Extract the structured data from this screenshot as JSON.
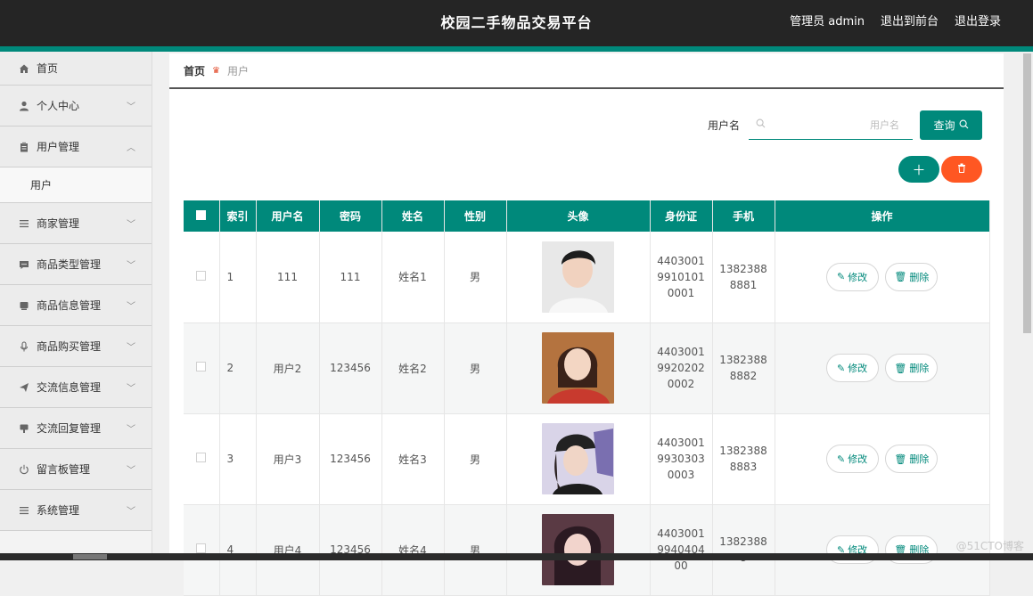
{
  "header": {
    "title": "校园二手物品交易平台",
    "admin_label": "管理员 admin",
    "back_to_front": "退出到前台",
    "logout": "退出登录"
  },
  "sidebar": {
    "items": [
      {
        "label": "首页",
        "icon": "home-icon"
      },
      {
        "label": "个人中心",
        "icon": "user-icon"
      },
      {
        "label": "用户管理",
        "icon": "clipboard-icon"
      },
      {
        "label": "商家管理",
        "icon": "list-icon"
      },
      {
        "label": "商品类型管理",
        "icon": "chat-icon"
      },
      {
        "label": "商品信息管理",
        "icon": "box-icon"
      },
      {
        "label": "商品购买管理",
        "icon": "mic-icon"
      },
      {
        "label": "交流信息管理",
        "icon": "send-icon"
      },
      {
        "label": "交流回复管理",
        "icon": "reply-icon"
      },
      {
        "label": "留言板管理",
        "icon": "power-icon"
      },
      {
        "label": "系统管理",
        "icon": "settings-list-icon"
      }
    ],
    "submenu": {
      "label": "用户"
    }
  },
  "breadcrumb": {
    "home": "首页",
    "current": "用户"
  },
  "search": {
    "label": "用户名",
    "placeholder": "用户名",
    "button": "查询"
  },
  "table": {
    "headers": [
      "索引",
      "用户名",
      "密码",
      "姓名",
      "性别",
      "头像",
      "身份证",
      "手机",
      "操作"
    ],
    "rows": [
      {
        "index": "1",
        "username": "111",
        "password": "111",
        "name": "姓名1",
        "gender": "男",
        "id_card": "440300199101010001",
        "phone": "13823888881"
      },
      {
        "index": "2",
        "username": "用户2",
        "password": "123456",
        "name": "姓名2",
        "gender": "男",
        "id_card": "440300199202020002",
        "phone": "13823888882"
      },
      {
        "index": "3",
        "username": "用户3",
        "password": "123456",
        "name": "姓名3",
        "gender": "男",
        "id_card": "440300199303030003",
        "phone": "13823888883"
      },
      {
        "index": "4",
        "username": "用户4",
        "password": "123456",
        "name": "姓名4",
        "gender": "男",
        "id_card": "4403001994040400",
        "phone": "13823888"
      }
    ],
    "edit_label": "修改",
    "delete_label": "删除"
  },
  "watermark": "@51CTO博客",
  "colors": {
    "accent": "#00897b",
    "danger": "#ff5722",
    "topbar": "#252525"
  }
}
